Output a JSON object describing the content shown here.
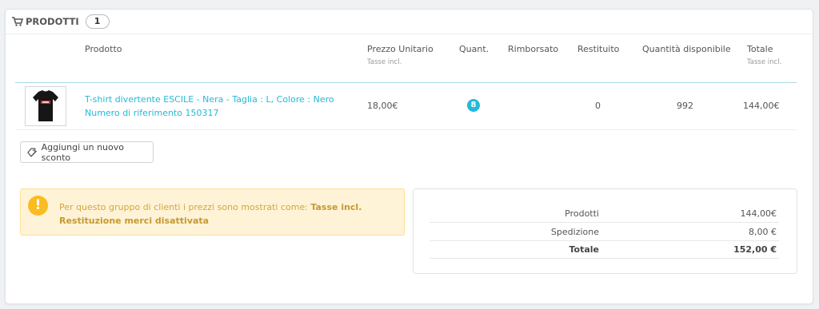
{
  "panel": {
    "title": "PRODOTTI",
    "count": "1"
  },
  "table": {
    "headers": {
      "product": "Prodotto",
      "unit_price": "Prezzo Unitario",
      "unit_price_sub": "Tasse incl.",
      "qty": "Quant.",
      "refunded": "Rimborsato",
      "returned": "Restituito",
      "available": "Quantità disponibile",
      "total": "Totale",
      "total_sub": "Tasse incl."
    },
    "rows": [
      {
        "name_line1": "T-shirt divertente ESCILE - Nera - Taglia : L, Colore : Nero",
        "name_line2": "Numero di riferimento 150317",
        "unit_price": "18,00€",
        "qty": "8",
        "refunded": "",
        "returned": "0",
        "available": "992",
        "total": "144,00€"
      }
    ]
  },
  "add_discount_button": "Aggiungi un nuovo sconto",
  "alert": {
    "line1_prefix": "Per questo gruppo di clienti i prezzi sono mostrati come: ",
    "line1_strong": "Tasse incl.",
    "line2": "Restituzione merci disattivata"
  },
  "totals": [
    {
      "label": "Prodotti",
      "value": "144,00€"
    },
    {
      "label": "Spedizione",
      "value": "8,00 €"
    },
    {
      "label": "Totale",
      "value": "152,00 €"
    }
  ],
  "colors": {
    "accent": "#25b9d7",
    "warning_bg": "#fff3d7",
    "warning_icon": "#fbbb22"
  }
}
